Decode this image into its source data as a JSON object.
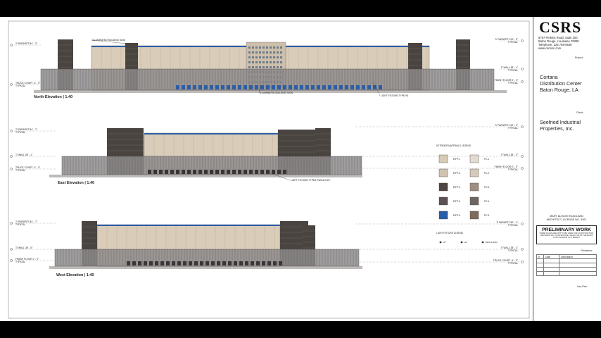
{
  "firm": {
    "logo": "CSRS",
    "address_lines": [
      "6767 Perkins Road, Suite 200",
      "Baton Rouge, Louisiana 70808",
      "Telephone: 225 769-0546",
      "www.csrsinc.com"
    ]
  },
  "project": {
    "label": "Project:",
    "name_lines": [
      "Cortana",
      "Distribution Center",
      "Baton Rouge, LA"
    ]
  },
  "client": {
    "label": "Client:",
    "name_lines": [
      "Seefried Industrial",
      "Properties, Inc."
    ]
  },
  "architect": {
    "lines": [
      "MARY ALISON HOAGLAND",
      "ARCHITECT, LICENSE NO. 3301"
    ]
  },
  "preliminary": {
    "title": "PRELIMINARY WORK",
    "note": "THESE PLANS ARE NOT TO BE USED FOR CONSTRUCTION, RECORDATION, CONVEYANCE, SALES, OR AS THE BASIS FOR ISSUANCE OF A PERMIT"
  },
  "revisions": {
    "label": "Revisions:",
    "headers": [
      "#",
      "Date",
      "Description"
    ]
  },
  "key_plan_label": "Key Plan",
  "elevations": [
    {
      "title": "North Elevation  |  1:40",
      "left_tags": [
        "T/ PARAPET  84' - 3\"",
        "TRUCK COURT  -4' - 0\"",
        "TYPICAL"
      ],
      "right_tags": [
        "T/ PARAPET  100' - 0\"",
        "TYPICAL",
        "T/ WALL  38' - 1\"",
        "TYPICAL",
        "FINISH FLOOR  0' - 0\"",
        "TYPICAL"
      ],
      "callouts": [
        "ILLUMINATED BUILDING SIGN",
        "ILLUMINATED BUILDING SIGN",
        "LIGHT FIXTURE TYPE H3"
      ]
    },
    {
      "title": "East Elevation  |  1:40",
      "left_tags": [
        "T/ PARAPET  84' - 7\"",
        "TYPICAL",
        "T/ WALL  38' - 1\"",
        "TRUCK COURT  -4' - 0\"",
        "TYPICAL"
      ],
      "right_tags": [
        "T/ PARAPET  100' - 0\"",
        "TYPICAL",
        "T/ WALL  38' - 0\"",
        "FINISH FLOOR  0' - 0\"",
        "TYPICAL"
      ],
      "callouts": [
        "LIGHT FIXTURE TYPES EW3 & EW3"
      ]
    },
    {
      "title": "West Elevation  |  1:40",
      "left_tags": [
        "T/ PARAPET  84' - 7\"",
        "TYPICAL",
        "T/ WALL  38' - 0\"",
        "FINISH FLOOR  0' - 0\"",
        "TYPICAL"
      ],
      "right_tags": [
        "T/ PARAPET  50' - 1\"",
        "TYPICAL",
        "T/ WALL  38' - 1\"",
        "TYPICAL",
        "TRUCK COURT  -4' - 0\"",
        "TYPICAL"
      ],
      "callouts": []
    }
  ],
  "legend": {
    "title": "EXTERIOR MATERIALS LEGEND",
    "items": [
      {
        "code": "EIFP-1",
        "color": "#d8cbb5"
      },
      {
        "code": "EIFP-2",
        "color": "#cfc3b0"
      },
      {
        "code": "EIFP-3",
        "color": "#4e4542"
      },
      {
        "code": "EIFP-5",
        "color": "#595152"
      },
      {
        "code": "EIFP-6",
        "color": "#2a5ea8"
      },
      {
        "code": "PC-1",
        "color": "#e3dbd0"
      },
      {
        "code": "PC-2",
        "color": "#d5c9b9"
      },
      {
        "code": "PC-3",
        "color": "#9e8f82"
      },
      {
        "code": "PC-4",
        "color": "#6d6461"
      },
      {
        "code": "PC-5",
        "color": "#7d6a5d"
      }
    ],
    "light_title": "LIGHT FIXTURE LEGEND",
    "light_items": [
      "H7",
      "H3",
      "EW3 & EW3"
    ]
  },
  "colors": {
    "panel_light": "#d9ccb9",
    "panel_dark": "#4a4441",
    "base_gray": "#8f8c8d",
    "accent_blue": "#2b5ea8"
  }
}
